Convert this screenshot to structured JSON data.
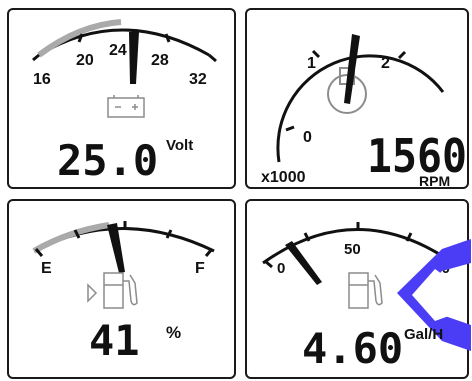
{
  "voltage": {
    "scale": [
      "16",
      "20",
      "24",
      "28",
      "32"
    ],
    "value": "25.0",
    "unit": "Volt",
    "icon": "battery-icon"
  },
  "tachometer": {
    "scale": [
      "0",
      "1",
      "2"
    ],
    "multiplier": "x1000",
    "value": "1560",
    "unit": "RPM",
    "icon": "engine-icon"
  },
  "fuel_level": {
    "scale_empty": "E",
    "scale_full": "F",
    "value": "41",
    "unit": "%",
    "icon": "fuel-pump-icon"
  },
  "fuel_rate": {
    "scale": [
      "0",
      "50",
      "100"
    ],
    "value": "4.60",
    "unit": "Gal/H",
    "icon": "fuel-pump-icon"
  },
  "colors": {
    "needle": "#111111",
    "arc_fill": "#aaaaaa",
    "icon": "#8c8c8c",
    "overlay": "#4b3df5"
  }
}
